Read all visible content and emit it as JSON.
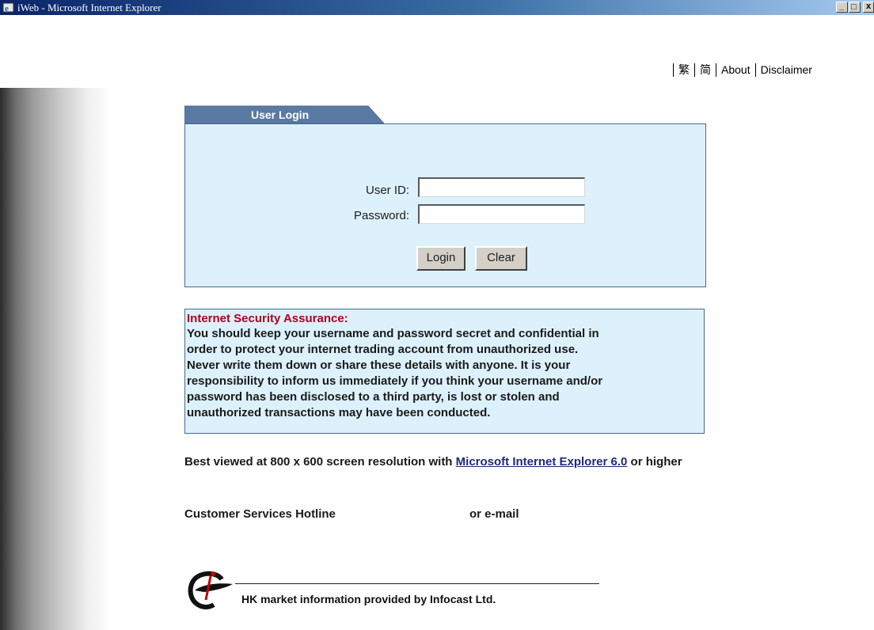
{
  "window": {
    "title": "iWeb - Microsoft Internet Explorer",
    "minimize": "_",
    "maximize": "□",
    "close": "x"
  },
  "topnav": {
    "items": [
      "繁",
      "简",
      "About",
      "Disclaimer"
    ]
  },
  "login": {
    "tab_label": "User Login",
    "userid_label": "User ID:",
    "password_label": "Password:",
    "userid_value": "",
    "password_value": "",
    "login_button": "Login",
    "clear_button": "Clear"
  },
  "security": {
    "title": "Internet Security Assurance:",
    "lines": [
      "You should keep your username and password secret and confidential in",
      "order to protect your internet trading account from unauthorized use.",
      "Never write them down or share these details with anyone. It is your",
      "responsibility to inform us immediately if you think your username and/or",
      "password has been disclosed to a third party, is lost or stolen and",
      "unauthorized transactions may have been conducted."
    ]
  },
  "bestview": {
    "prefix": "Best viewed at 800 x 600 screen resolution with ",
    "link": "Microsoft Internet Explorer 6.0",
    "suffix": " or higher"
  },
  "contact": {
    "hotline": "Customer Services Hotline",
    "email": "or e-mail"
  },
  "footer": {
    "text": "HK market information provided by Infocast Ltd."
  },
  "colors": {
    "panel_bg": "#dcf1fb",
    "tab_bg": "#5b7aa3",
    "warning_title": "#b00020",
    "link": "#1f2a7a"
  }
}
